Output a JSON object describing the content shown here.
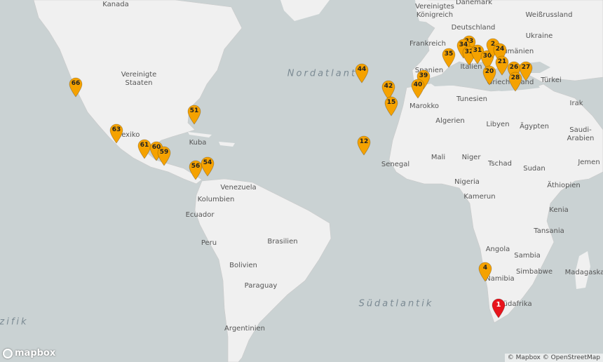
{
  "map": {
    "ocean_labels": [
      "Nordatlantik",
      "Südatlantik",
      "zifik"
    ],
    "place_labels": [
      "Kanada",
      "Vereinigte Staaten",
      "Mexiko",
      "Kuba",
      "Venezuela",
      "Kolumbien",
      "Ecuador",
      "Peru",
      "Brasilien",
      "Bolivien",
      "Paraguay",
      "Argentinien",
      "Vereinigtes Königreich",
      "Dänemark",
      "Deutschland",
      "Weißrussland",
      "Frankreich",
      "Ukraine",
      "Rumänien",
      "Spanien",
      "Italien",
      "Griechenland",
      "Türkei",
      "Marokko",
      "Tunesien",
      "Algerien",
      "Libyen",
      "Ägypten",
      "Irak",
      "Saudi-Arabien",
      "Jemen",
      "Senegal",
      "Mali",
      "Niger",
      "Tschad",
      "Sudan",
      "Äthiopien",
      "Nigeria",
      "Kamerun",
      "Kenia",
      "Tansania",
      "Angola",
      "Sambia",
      "Simbabwe",
      "Namibia",
      "Südafrika",
      "Madagaskar"
    ],
    "marker_color": "#f5a200",
    "selected_marker_color": "#e8141c",
    "markers": [
      "66",
      "51",
      "63",
      "61",
      "60",
      "59",
      "56",
      "54",
      "44",
      "42",
      "15",
      "12",
      "39",
      "40",
      "35",
      "33",
      "34",
      "32",
      "31",
      "30",
      "2",
      "24",
      "21",
      "20",
      "26",
      "27",
      "28",
      "4",
      "1"
    ],
    "selected_marker": "1"
  },
  "logo": {
    "text": "mapbox"
  },
  "attribution": {
    "mapbox": "© Mapbox",
    "osm": "© OpenStreetMap"
  }
}
